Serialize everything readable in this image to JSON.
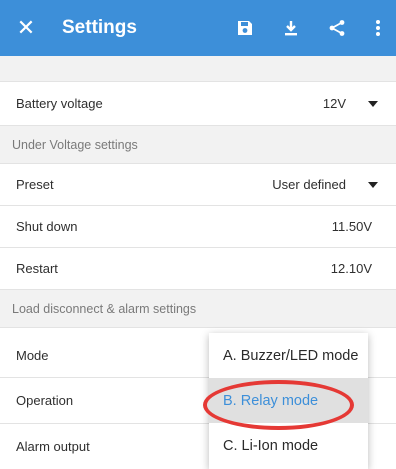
{
  "appbar": {
    "title": "Settings",
    "close_icon": "close-icon",
    "actions": [
      "save-icon",
      "download-icon",
      "share-icon",
      "more-vert-icon"
    ],
    "color": "#3d8fd9"
  },
  "rows": {
    "battery_voltage": {
      "label": "Battery voltage",
      "value": "12V"
    },
    "under_voltage_header": "Under Voltage settings",
    "preset": {
      "label": "Preset",
      "value": "User defined"
    },
    "shut_down": {
      "label": "Shut down",
      "value": "11.50V"
    },
    "restart": {
      "label": "Restart",
      "value": "12.10V"
    },
    "load_disconnect_header": "Load disconnect & alarm settings",
    "mode": {
      "label": "Mode"
    },
    "operation": {
      "label": "Operation"
    },
    "alarm_output": {
      "label": "Alarm output"
    }
  },
  "menu": {
    "options": [
      "A. Buzzer/LED mode",
      "B. Relay mode",
      "C. Li-Ion mode"
    ],
    "selected": "B. Relay mode",
    "highlight_color": "#e53935"
  }
}
